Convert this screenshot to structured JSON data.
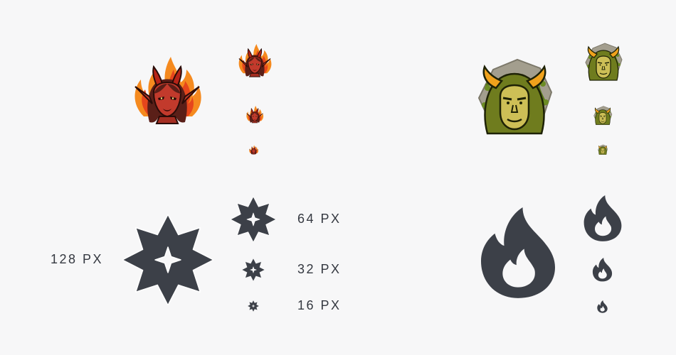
{
  "labels": {
    "size_128": "128 PX",
    "size_64": "64 PX",
    "size_32": "32 PX",
    "size_16": "16 PX"
  },
  "colors": {
    "background": "#f7f7f8",
    "glyph": "#3c4048",
    "label": "#343840",
    "demon_skin": "#c23a2c",
    "demon_hair": "#5a1f18",
    "flame_orange": "#f58a1f",
    "flame_red": "#e6461c",
    "horn_red": "#b82418",
    "ogre_skin": "#cdbf56",
    "ogre_hood": "#6f7c1e",
    "ogre_horn": "#f0a21c",
    "rock": "#a39e8e"
  },
  "icons": {
    "left_avatar": "demon-girl-emote",
    "right_avatar": "horned-ogre-emote",
    "left_glyph": "four-point-star-badge",
    "right_glyph": "flame-badge"
  }
}
